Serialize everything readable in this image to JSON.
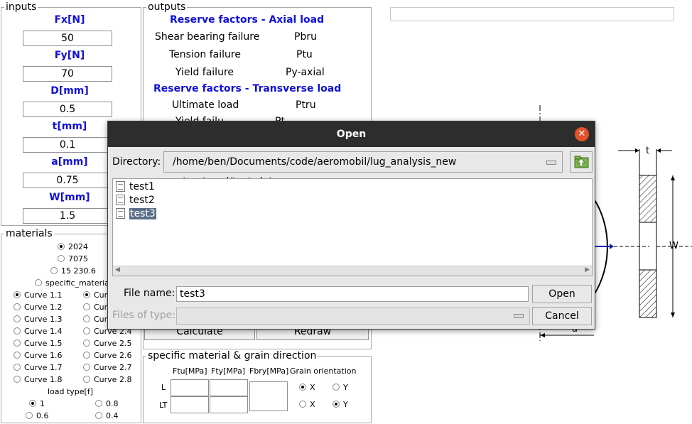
{
  "inputs": {
    "title": "inputs",
    "fields": [
      {
        "label": "Fx[N]",
        "value": "50"
      },
      {
        "label": "Fy[N]",
        "value": "70"
      },
      {
        "label": "D[mm]",
        "value": "0.5"
      },
      {
        "label": "t[mm]",
        "value": "0.1"
      },
      {
        "label": "a[mm]",
        "value": "0.75"
      },
      {
        "label": "W[mm]",
        "value": "1.5"
      }
    ]
  },
  "materials": {
    "title": "materials",
    "options": [
      "2024",
      "7075",
      "15 230.6",
      "specific_materia"
    ],
    "curves_left": [
      "Curve 1.1",
      "Curve 1.2",
      "Curve 1.3",
      "Curve 1.4",
      "Curve 1.5",
      "Curve 1.6",
      "Curve 1.7",
      "Curve 1.8"
    ],
    "curves_right": [
      "Curv",
      "Cur",
      "Cur",
      "Curve 2.4",
      "Curve 2.5",
      "Curve 2.6",
      "Curve 2.7",
      "Curve 2.8"
    ],
    "load_type_label": "load type[f]",
    "load_types": [
      "1",
      "0.8",
      "0.6",
      "0.4"
    ]
  },
  "outputs": {
    "title": "outputs",
    "axial_heading": "Reserve factors - Axial load",
    "axial_rows": [
      {
        "name": "Shear bearing failure",
        "symbol": "Pbru"
      },
      {
        "name": "Tension failure",
        "symbol": "Ptu"
      },
      {
        "name": "Yield failure",
        "symbol": "Py-axial"
      }
    ],
    "transverse_heading": "Reserve factors - Transverse load",
    "transverse_rows": [
      {
        "name": "Ultimate load",
        "symbol": "Ptru"
      },
      {
        "name": "Yield failu",
        "symbol": "Pt"
      }
    ],
    "calculate_label": "Calculate",
    "redraw_label": "Redraw"
  },
  "specific": {
    "title": "specific material & grain direction",
    "col_ftu": "Ftu[MPa]",
    "col_fty": "Fty[MPa]",
    "col_fbry": "Fbry[MPa]",
    "col_grain": "Grain orientation",
    "row_l": "L",
    "row_lt": "LT",
    "x_label": "X",
    "y_label": "Y"
  },
  "drawing": {
    "t_label": "t",
    "w_label": "W",
    "a_label": "a"
  },
  "dialog": {
    "title": "Open",
    "directory_label": "Directory:",
    "directory_value": "/home/ben/Documents/code/aeromobil/lug_analysis_new _structured/test_data",
    "files": [
      "test1",
      "test2",
      "test3"
    ],
    "selected_file": "test3",
    "file_name_label": "File name:",
    "file_name_value": "test3",
    "files_of_type_label": "Files of type:",
    "open_label": "Open",
    "cancel_label": "Cancel",
    "colors": {
      "titlebar": "#2d2d2d",
      "close": "#e4512a",
      "selection": "#5a6e87"
    }
  }
}
